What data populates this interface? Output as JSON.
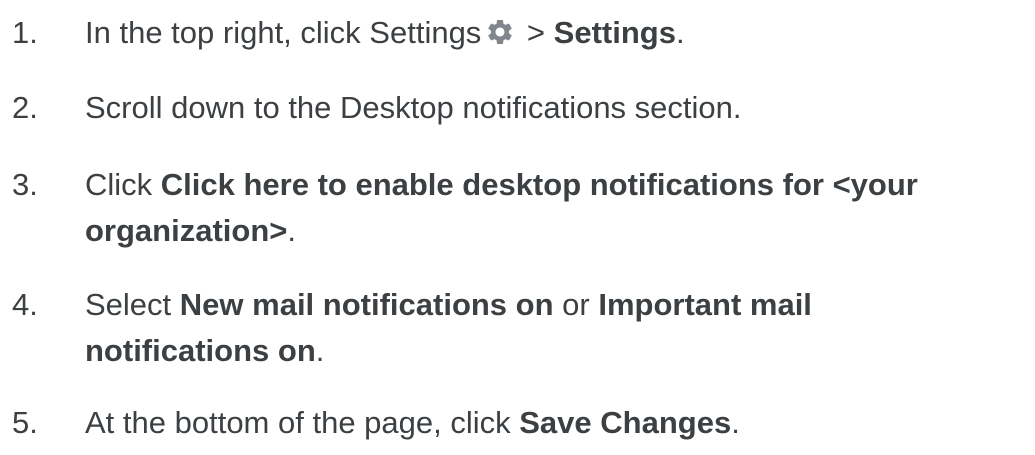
{
  "steps": [
    {
      "number": "1.",
      "before_icon": "In the top right, click Settings",
      "icon": "gear-icon",
      "separator": " > ",
      "bold": "Settings",
      "after": "."
    },
    {
      "number": "2.",
      "text": "Scroll down to the Desktop notifications section."
    },
    {
      "number": "3.",
      "prefix": "Click ",
      "bold_line1": "Click here to enable desktop notifications for <your",
      "bold_line2": "organization>",
      "after": "."
    },
    {
      "number": "4.",
      "prefix": "Select ",
      "bold1": "New mail notifications on",
      "middle": " or ",
      "bold2_line1": "Important mail",
      "bold2_line2": "notifications on",
      "after": "."
    },
    {
      "number": "5.",
      "prefix": "At the bottom of the page, click ",
      "bold": "Save Changes",
      "after": "."
    }
  ],
  "colors": {
    "text": "#3c4043",
    "icon": "#80868b",
    "background": "#ffffff"
  }
}
